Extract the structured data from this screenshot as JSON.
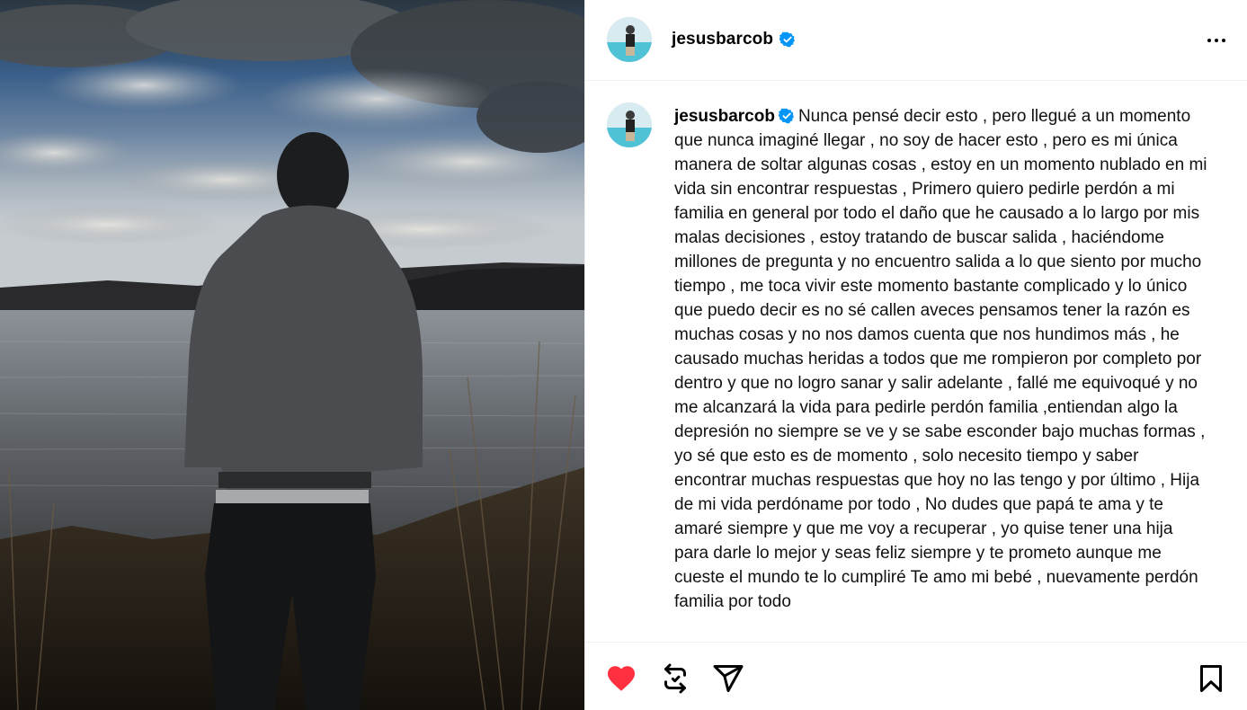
{
  "post": {
    "username": "jesusbarcob",
    "verified": true,
    "caption": "Nunca pensé decir esto , pero llegué a un momento que nunca imaginé llegar , no soy de hacer esto , pero es mi única manera de soltar algunas cosas , estoy en un momento nublado en mi vida sin encontrar respuestas , Primero quiero pedirle perdón a mi familia en general por todo el daño que he causado a lo largo por mis malas decisiones , estoy tratando de buscar salida , haciéndome millones de pregunta y no encuentro salida a lo que siento por mucho tiempo , me toca vivir este momento bastante complicado y lo único que puedo decir es no sé callen aveces pensamos tener la razón es muchas cosas y no nos damos cuenta que nos hundimos más , he causado muchas heridas a todos que me rompieron por completo por dentro y que no logro sanar y salir adelante , fallé me equivoqué y no me alcanzará la vida para pedirle perdón familia ,entiendan algo la depresión no siempre se ve y se sabe esconder bajo muchas formas , yo sé que esto es de momento , solo necesito tiempo y saber encontrar muchas respuestas que hoy no las tengo y por último , Hija de mi vida perdóname por todo , No dudes que papá te ama y te amaré siempre y que me voy a recuperar , yo quise tener una hija para darle lo mejor y seas feliz siempre y te prometo aunque me cueste el mundo te lo cumpliré Te amo mi bebé , nuevamente perdón familia por todo",
    "liked": true
  },
  "icons": {
    "more": "more-options-icon",
    "verified": "verified-badge-icon",
    "like": "heart-filled-icon",
    "repost": "repost-icon",
    "share": "send-icon",
    "save": "bookmark-icon"
  },
  "colors": {
    "like_red": "#ff3040",
    "verified_blue": "#0095f6",
    "border": "#efefef"
  }
}
